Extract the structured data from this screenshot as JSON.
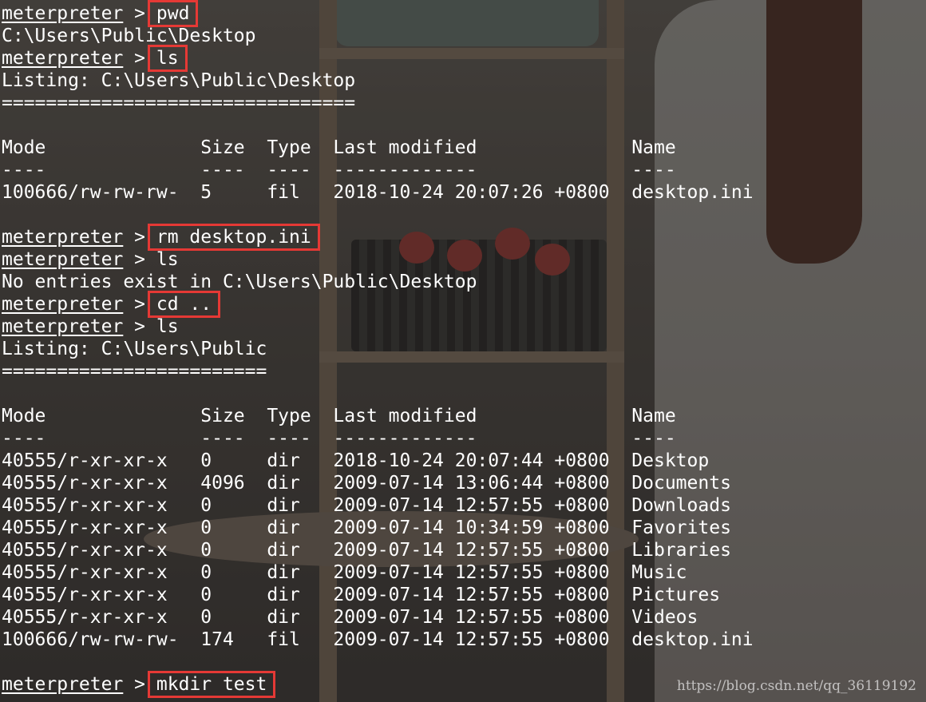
{
  "terminal": {
    "lines": [
      {
        "kind": "cmd",
        "prompt": "meterpreter",
        "sep": " > ",
        "text": "pwd",
        "boxed": true
      },
      {
        "kind": "out",
        "text": "C:\\Users\\Public\\Desktop"
      },
      {
        "kind": "cmd",
        "prompt": "meterpreter",
        "sep": " > ",
        "text": "ls",
        "boxed": true
      },
      {
        "kind": "out",
        "text": "Listing: C:\\Users\\Public\\Desktop"
      },
      {
        "kind": "out",
        "text": "================================"
      },
      {
        "kind": "out",
        "text": ""
      },
      {
        "kind": "out",
        "text": "Mode              Size  Type  Last modified              Name"
      },
      {
        "kind": "out",
        "text": "----              ----  ----  -------------              ----"
      },
      {
        "kind": "out",
        "text": "100666/rw-rw-rw-  5     fil   2018-10-24 20:07:26 +0800  desktop.ini"
      },
      {
        "kind": "out",
        "text": ""
      },
      {
        "kind": "cmd",
        "prompt": "meterpreter",
        "sep": " > ",
        "text": "rm desktop.ini",
        "boxed": true
      },
      {
        "kind": "cmd",
        "prompt": "meterpreter",
        "sep": " > ",
        "text": "ls",
        "boxed": false
      },
      {
        "kind": "out",
        "text": "No entries exist in C:\\Users\\Public\\Desktop"
      },
      {
        "kind": "cmd",
        "prompt": "meterpreter",
        "sep": " > ",
        "text": "cd ..",
        "boxed": true
      },
      {
        "kind": "cmd",
        "prompt": "meterpreter",
        "sep": " > ",
        "text": "ls",
        "boxed": false
      },
      {
        "kind": "out",
        "text": "Listing: C:\\Users\\Public"
      },
      {
        "kind": "out",
        "text": "========================"
      },
      {
        "kind": "out",
        "text": ""
      },
      {
        "kind": "out",
        "text": "Mode              Size  Type  Last modified              Name"
      },
      {
        "kind": "out",
        "text": "----              ----  ----  -------------              ----"
      },
      {
        "kind": "out",
        "text": "40555/r-xr-xr-x   0     dir   2018-10-24 20:07:44 +0800  Desktop"
      },
      {
        "kind": "out",
        "text": "40555/r-xr-xr-x   4096  dir   2009-07-14 13:06:44 +0800  Documents"
      },
      {
        "kind": "out",
        "text": "40555/r-xr-xr-x   0     dir   2009-07-14 12:57:55 +0800  Downloads"
      },
      {
        "kind": "out",
        "text": "40555/r-xr-xr-x   0     dir   2009-07-14 10:34:59 +0800  Favorites"
      },
      {
        "kind": "out",
        "text": "40555/r-xr-xr-x   0     dir   2009-07-14 12:57:55 +0800  Libraries"
      },
      {
        "kind": "out",
        "text": "40555/r-xr-xr-x   0     dir   2009-07-14 12:57:55 +0800  Music"
      },
      {
        "kind": "out",
        "text": "40555/r-xr-xr-x   0     dir   2009-07-14 12:57:55 +0800  Pictures"
      },
      {
        "kind": "out",
        "text": "40555/r-xr-xr-x   0     dir   2009-07-14 12:57:55 +0800  Videos"
      },
      {
        "kind": "out",
        "text": "100666/rw-rw-rw-  174   fil   2009-07-14 12:57:55 +0800  desktop.ini"
      },
      {
        "kind": "out",
        "text": ""
      },
      {
        "kind": "cmd",
        "prompt": "meterpreter",
        "sep": " > ",
        "text": "mkdir test",
        "boxed": true
      }
    ]
  },
  "watermark": "https://blog.csdn.net/qq_36119192",
  "colors": {
    "text": "#ffffff",
    "highlight_box": "#e53935"
  }
}
